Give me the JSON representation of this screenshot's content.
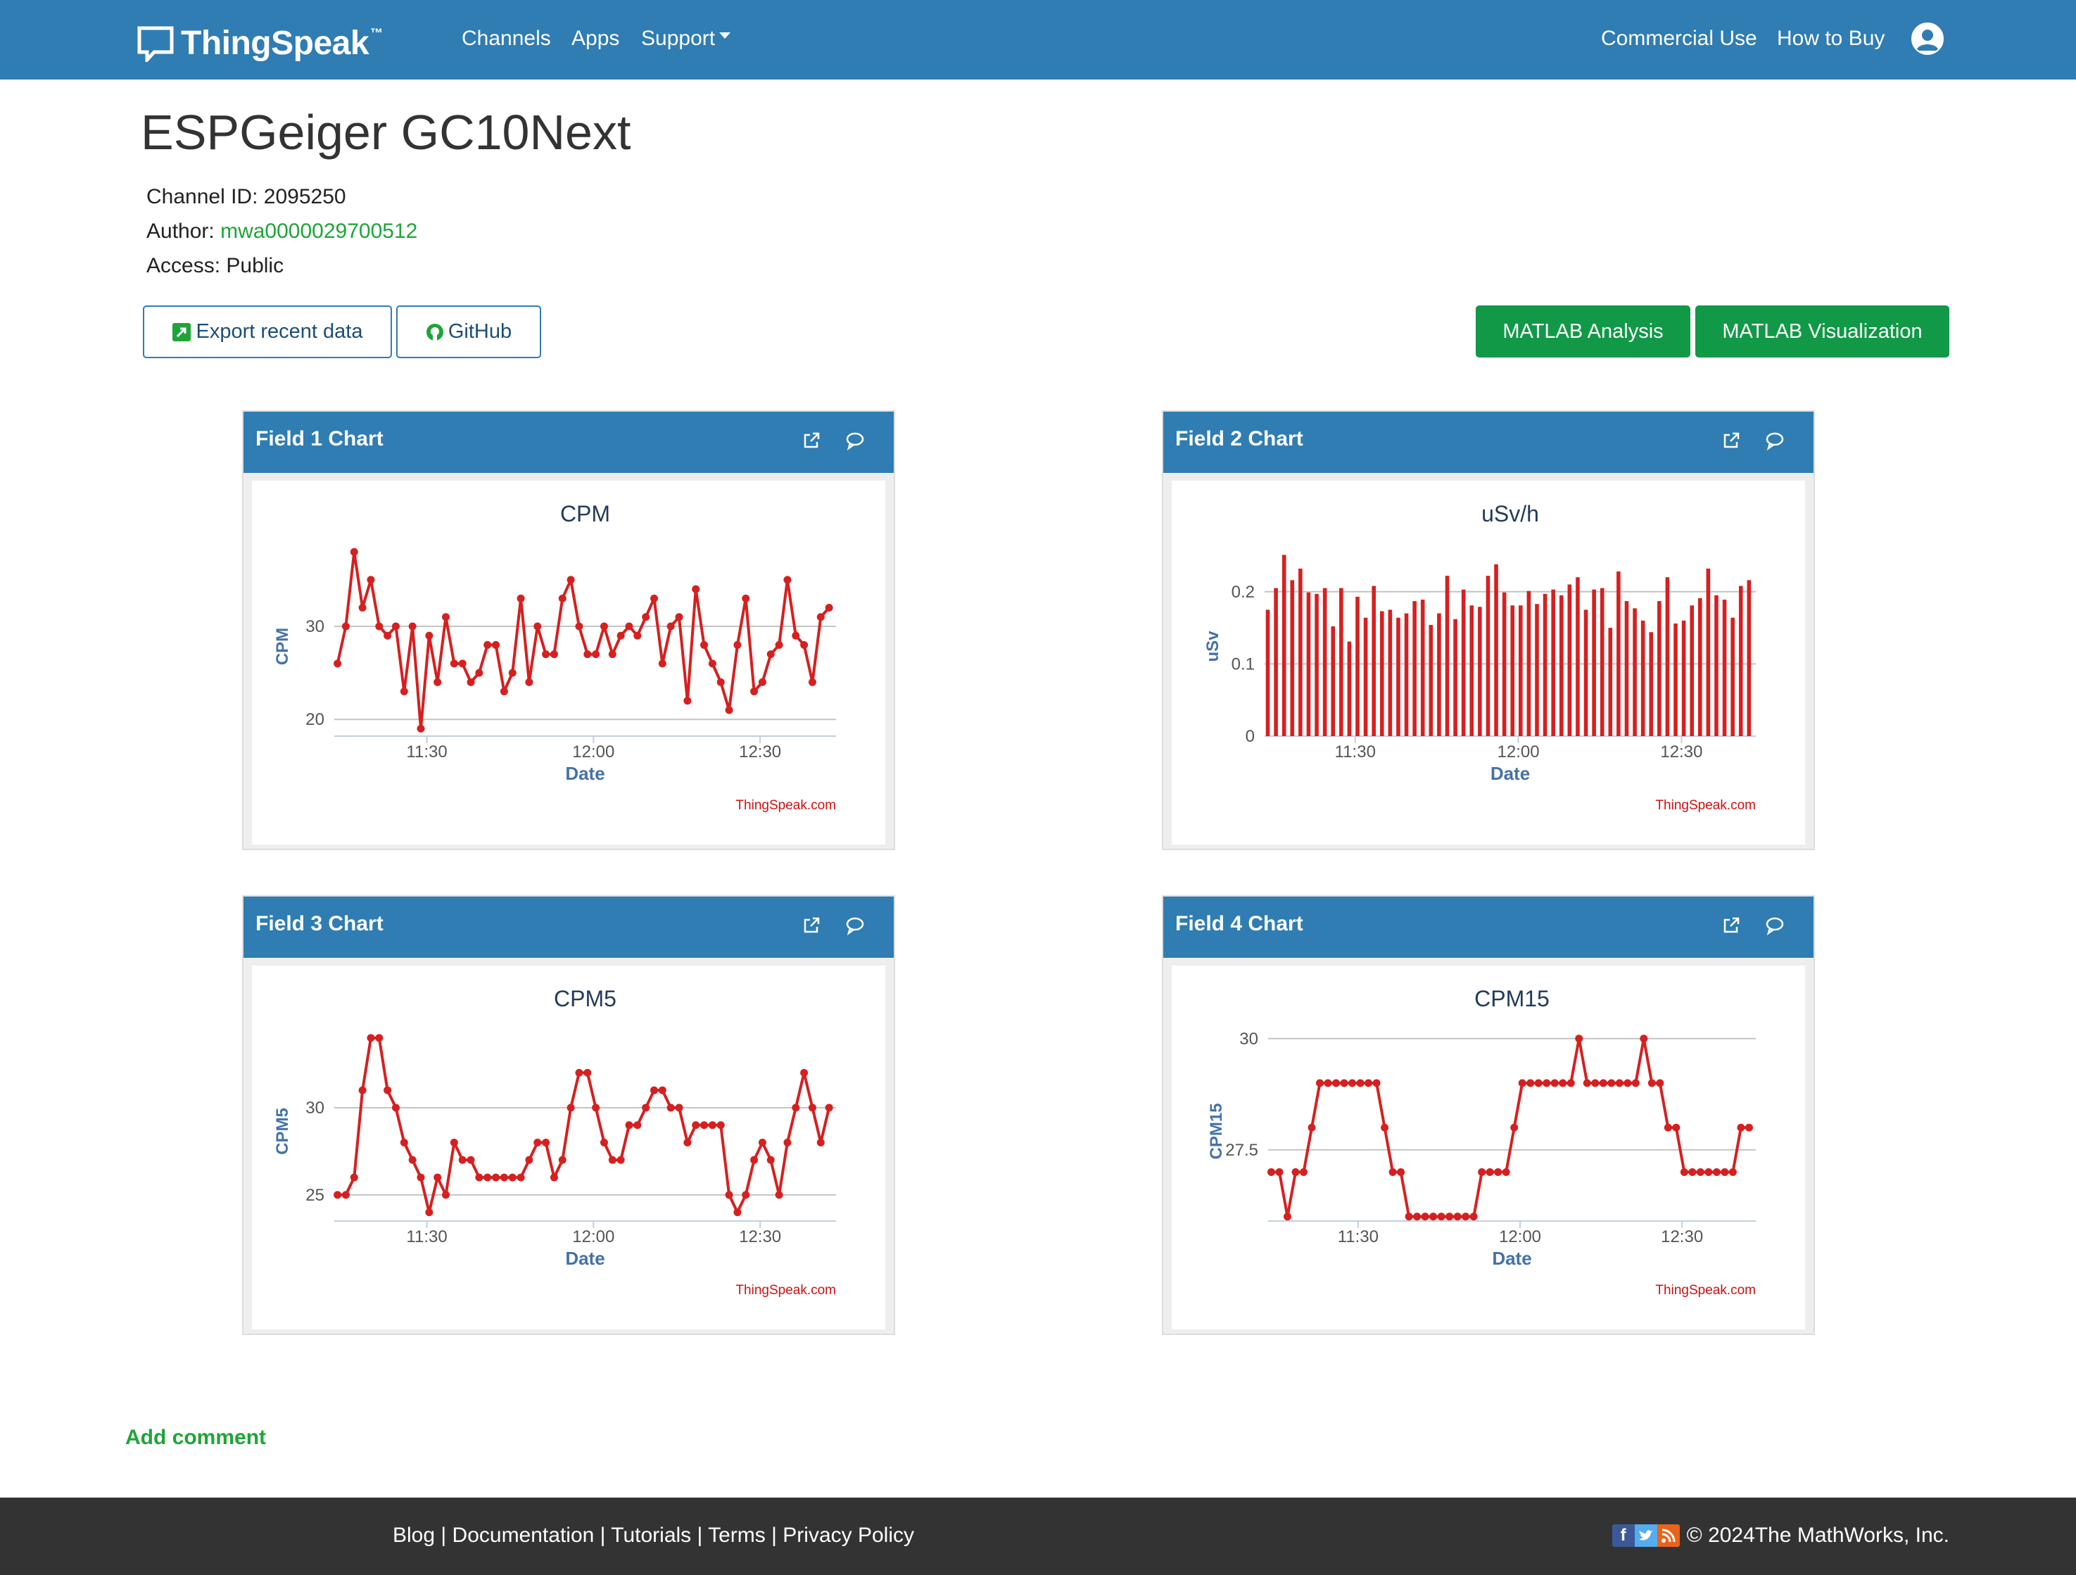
{
  "nav": {
    "brand": "ThingSpeak",
    "trademark": "™",
    "links": [
      "Channels",
      "Apps",
      "Support"
    ],
    "right_links": [
      "Commercial Use",
      "How to Buy"
    ],
    "color": "#2f7db2"
  },
  "channel": {
    "title": "ESPGeiger GC10Next",
    "id_label": "Channel ID:",
    "id": "2095250",
    "author_label": "Author:",
    "author": "mwa0000029700512",
    "access_label": "Access:",
    "access": "Public"
  },
  "buttons": {
    "export": "Export recent data",
    "github": "GitHub",
    "matlab_analysis": "MATLAB Analysis",
    "matlab_visualization": "MATLAB Visualization"
  },
  "cards": [
    {
      "title": "Field 1 Chart"
    },
    {
      "title": "Field 2 Chart"
    },
    {
      "title": "Field 3 Chart"
    },
    {
      "title": "Field 4 Chart"
    }
  ],
  "chart_data": [
    {
      "type": "line",
      "title": "CPM",
      "xlabel": "Date",
      "ylabel": "CPM",
      "credit": "ThingSpeak.com",
      "color": "#d62020",
      "grid": true,
      "ylim": [
        18.2,
        39.0
      ],
      "yticks": [
        "20",
        "30"
      ],
      "xlim": [
        "11:13:20",
        "12:43:40"
      ],
      "xticks": [
        "11:30",
        "12:00",
        "12:30"
      ],
      "x": [
        "11:13:55",
        "11:15:25",
        "11:16:55",
        "11:18:25",
        "11:19:55",
        "11:21:25",
        "11:22:55",
        "11:24:25",
        "11:25:55",
        "11:27:25",
        "11:28:55",
        "11:30:25",
        "11:31:55",
        "11:33:25",
        "11:34:55",
        "11:36:25",
        "11:37:55",
        "11:39:25",
        "11:40:55",
        "11:42:25",
        "11:43:55",
        "11:45:25",
        "11:46:55",
        "11:48:25",
        "11:49:55",
        "11:51:25",
        "11:52:55",
        "11:54:25",
        "11:55:55",
        "11:57:25",
        "11:58:55",
        "12:00:25",
        "12:01:55",
        "12:03:25",
        "12:04:55",
        "12:06:25",
        "12:07:55",
        "12:09:25",
        "12:10:55",
        "12:12:25",
        "12:13:55",
        "12:15:25",
        "12:16:55",
        "12:18:25",
        "12:19:55",
        "12:21:25",
        "12:22:55",
        "12:24:25",
        "12:25:55",
        "12:27:25",
        "12:28:55",
        "12:30:25",
        "12:31:55",
        "12:33:25",
        "12:34:55",
        "12:36:25",
        "12:37:55",
        "12:39:25",
        "12:40:55",
        "12:42:25"
      ],
      "values": [
        26,
        30,
        38,
        32,
        35,
        30,
        29,
        30,
        23,
        30,
        19,
        29,
        24,
        31,
        26,
        26,
        24,
        25,
        28,
        28,
        23,
        25,
        33,
        24,
        30,
        27,
        27,
        33,
        35,
        30,
        27,
        27,
        30,
        27,
        29,
        30,
        29,
        31,
        33,
        26,
        30,
        31,
        22,
        34,
        28,
        26,
        24,
        21,
        28,
        33,
        23,
        24,
        27,
        28,
        35,
        29,
        28,
        24,
        31,
        32
      ]
    },
    {
      "type": "bar",
      "title": "uSv/h",
      "xlabel": "Date",
      "ylabel": "uSv",
      "credit": "ThingSpeak.com",
      "color": "#d62020",
      "grid": true,
      "ylim": [
        0,
        0.268
      ],
      "yticks": [
        "0",
        "0.1",
        "0.2"
      ],
      "xlim": [
        "11:13:20",
        "12:43:40"
      ],
      "xticks": [
        "11:30",
        "12:00",
        "12:30"
      ],
      "x": [
        "11:13:55",
        "11:15:25",
        "11:16:55",
        "11:18:25",
        "11:19:55",
        "11:21:25",
        "11:22:55",
        "11:24:25",
        "11:25:55",
        "11:27:25",
        "11:28:55",
        "11:30:25",
        "11:31:55",
        "11:33:25",
        "11:34:55",
        "11:36:25",
        "11:37:55",
        "11:39:25",
        "11:40:55",
        "11:42:25",
        "11:43:55",
        "11:45:25",
        "11:46:55",
        "11:48:25",
        "11:49:55",
        "11:51:25",
        "11:52:55",
        "11:54:25",
        "11:55:55",
        "11:57:25",
        "11:58:55",
        "12:00:25",
        "12:01:55",
        "12:03:25",
        "12:04:55",
        "12:06:25",
        "12:07:55",
        "12:09:25",
        "12:10:55",
        "12:12:25",
        "12:13:55",
        "12:15:25",
        "12:16:55",
        "12:18:25",
        "12:19:55",
        "12:21:25",
        "12:22:55",
        "12:24:25",
        "12:25:55",
        "12:27:25",
        "12:28:55",
        "12:30:25",
        "12:31:55",
        "12:33:25",
        "12:34:55",
        "12:36:25",
        "12:37:55",
        "12:39:25",
        "12:40:55",
        "12:42:25"
      ],
      "values": [
        0.175,
        0.205,
        0.251,
        0.216,
        0.232,
        0.199,
        0.197,
        0.205,
        0.152,
        0.205,
        0.131,
        0.193,
        0.164,
        0.208,
        0.173,
        0.175,
        0.164,
        0.17,
        0.187,
        0.189,
        0.154,
        0.17,
        0.222,
        0.162,
        0.203,
        0.181,
        0.179,
        0.222,
        0.238,
        0.199,
        0.181,
        0.181,
        0.201,
        0.183,
        0.197,
        0.203,
        0.195,
        0.21,
        0.22,
        0.175,
        0.203,
        0.205,
        0.15,
        0.228,
        0.187,
        0.177,
        0.16,
        0.144,
        0.187,
        0.22,
        0.156,
        0.16,
        0.181,
        0.191,
        0.232,
        0.195,
        0.189,
        0.164,
        0.208,
        0.216
      ]
    },
    {
      "type": "line",
      "title": "CPM5",
      "xlabel": "Date",
      "ylabel": "CPM5",
      "credit": "ThingSpeak.com",
      "color": "#d62020",
      "grid": true,
      "ylim": [
        23.5,
        34.6
      ],
      "yticks": [
        "25",
        "30"
      ],
      "xlim": [
        "11:13:20",
        "12:43:40"
      ],
      "xticks": [
        "11:30",
        "12:00",
        "12:30"
      ],
      "x": [
        "11:13:55",
        "11:15:25",
        "11:16:55",
        "11:18:25",
        "11:19:55",
        "11:21:25",
        "11:22:55",
        "11:24:25",
        "11:25:55",
        "11:27:25",
        "11:28:55",
        "11:30:25",
        "11:31:55",
        "11:33:25",
        "11:34:55",
        "11:36:25",
        "11:37:55",
        "11:39:25",
        "11:40:55",
        "11:42:25",
        "11:43:55",
        "11:45:25",
        "11:46:55",
        "11:48:25",
        "11:49:55",
        "11:51:25",
        "11:52:55",
        "11:54:25",
        "11:55:55",
        "11:57:25",
        "11:58:55",
        "12:00:25",
        "12:01:55",
        "12:03:25",
        "12:04:55",
        "12:06:25",
        "12:07:55",
        "12:09:25",
        "12:10:55",
        "12:12:25",
        "12:13:55",
        "12:15:25",
        "12:16:55",
        "12:18:25",
        "12:19:55",
        "12:21:25",
        "12:22:55",
        "12:24:25",
        "12:25:55",
        "12:27:25",
        "12:28:55",
        "12:30:25",
        "12:31:55",
        "12:33:25",
        "12:34:55",
        "12:36:25",
        "12:37:55",
        "12:39:25",
        "12:40:55",
        "12:42:25"
      ],
      "values": [
        25,
        25,
        26,
        31,
        34,
        34,
        31,
        30,
        28,
        27,
        26,
        24,
        26,
        25,
        28,
        27,
        27,
        26,
        26,
        26,
        26,
        26,
        26,
        27,
        28,
        28,
        26,
        27,
        30,
        32,
        32,
        30,
        28,
        27,
        27,
        29,
        29,
        30,
        31,
        31,
        30,
        30,
        28,
        29,
        29,
        29,
        29,
        25,
        24,
        25,
        27,
        28,
        27,
        25,
        28,
        30,
        32,
        30,
        28,
        30
      ]
    },
    {
      "type": "line",
      "title": "CPM15",
      "xlabel": "Date",
      "ylabel": "CPM15",
      "credit": "ThingSpeak.com",
      "color": "#d62020",
      "grid": true,
      "ylim": [
        25.9,
        30.25
      ],
      "yticks": [
        "27.5",
        "30"
      ],
      "xlim": [
        "11:13:20",
        "12:43:40"
      ],
      "xticks": [
        "11:30",
        "12:00",
        "12:30"
      ],
      "x": [
        "11:13:55",
        "11:15:25",
        "11:16:55",
        "11:18:25",
        "11:19:55",
        "11:21:25",
        "11:22:55",
        "11:24:25",
        "11:25:55",
        "11:27:25",
        "11:28:55",
        "11:30:25",
        "11:31:55",
        "11:33:25",
        "11:34:55",
        "11:36:25",
        "11:37:55",
        "11:39:25",
        "11:40:55",
        "11:42:25",
        "11:43:55",
        "11:45:25",
        "11:46:55",
        "11:48:25",
        "11:49:55",
        "11:51:25",
        "11:52:55",
        "11:54:25",
        "11:55:55",
        "11:57:25",
        "11:58:55",
        "12:00:25",
        "12:01:55",
        "12:03:25",
        "12:04:55",
        "12:06:25",
        "12:07:55",
        "12:09:25",
        "12:10:55",
        "12:12:25",
        "12:13:55",
        "12:15:25",
        "12:16:55",
        "12:18:25",
        "12:19:55",
        "12:21:25",
        "12:22:55",
        "12:24:25",
        "12:25:55",
        "12:27:25",
        "12:28:55",
        "12:30:25",
        "12:31:55",
        "12:33:25",
        "12:34:55",
        "12:36:25",
        "12:37:55",
        "12:39:25",
        "12:40:55",
        "12:42:25"
      ],
      "values": [
        27,
        27,
        26,
        27,
        27,
        28,
        29,
        29,
        29,
        29,
        29,
        29,
        29,
        29,
        28,
        27,
        27,
        26,
        26,
        26,
        26,
        26,
        26,
        26,
        26,
        26,
        27,
        27,
        27,
        27,
        28,
        29,
        29,
        29,
        29,
        29,
        29,
        29,
        30,
        29,
        29,
        29,
        29,
        29,
        29,
        29,
        30,
        29,
        29,
        28,
        28,
        27,
        27,
        27,
        27,
        27,
        27,
        27,
        28,
        28
      ]
    }
  ],
  "add_comment": "Add comment",
  "footer": {
    "links": [
      "Blog",
      "Documentation",
      "Tutorials",
      "Terms",
      "Privacy Policy"
    ],
    "separator": "|",
    "copyright": "© 2024The MathWorks, Inc."
  }
}
